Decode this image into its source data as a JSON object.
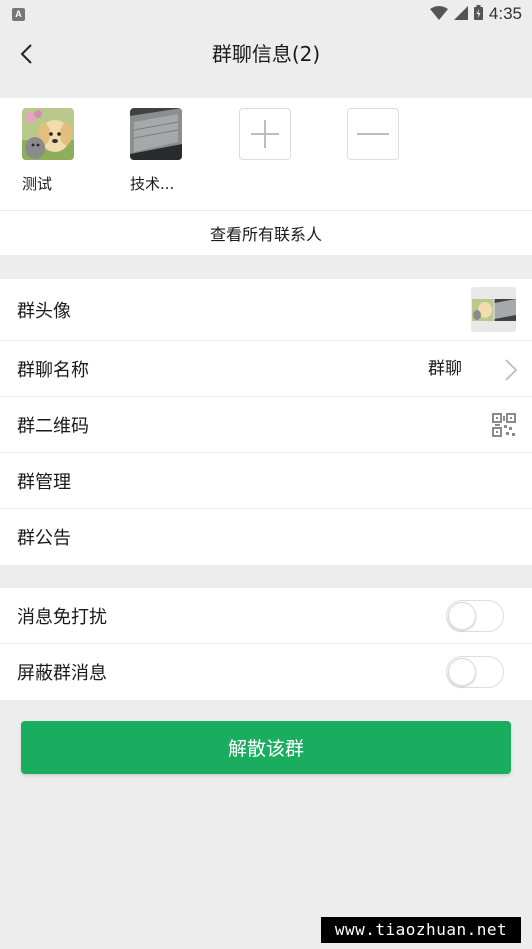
{
  "status_bar": {
    "notification_icon": "A",
    "time": "4:35"
  },
  "header": {
    "title": "群聊信息(2)",
    "back_icon": "chevron-left-icon"
  },
  "members": {
    "items": [
      {
        "name": "测试",
        "avatar": "dog-and-cat-photo"
      },
      {
        "name": "技术...",
        "avatar": "laptop-photo"
      }
    ],
    "add_icon": "plus-icon",
    "remove_icon": "minus-icon",
    "view_all_label": "查看所有联系人"
  },
  "settings": {
    "group_avatar_label": "群头像",
    "group_name_label": "群聊名称",
    "group_name_value": "群聊",
    "qr_code_label": "群二维码",
    "manage_label": "群管理",
    "announcement_label": "群公告"
  },
  "toggles": {
    "mute_label": "消息免打扰",
    "mute_on": false,
    "block_label": "屏蔽群消息",
    "block_on": false
  },
  "dissolve_button_label": "解散该群",
  "watermark": "www.tiaozhuan.net",
  "colors": {
    "accent_green": "#1aad5f",
    "background": "#ededed"
  }
}
